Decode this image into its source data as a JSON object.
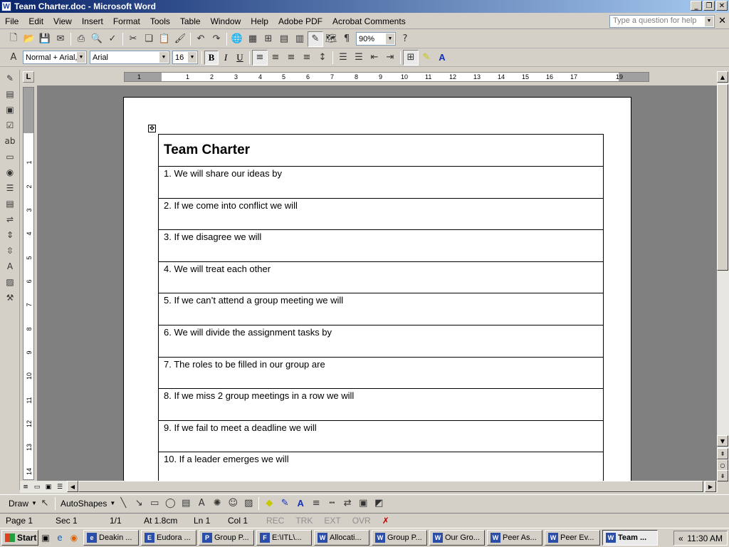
{
  "window": {
    "title": "Team Charter.doc - Microsoft Word",
    "app_icon": "W"
  },
  "menu": [
    "File",
    "Edit",
    "View",
    "Insert",
    "Format",
    "Tools",
    "Table",
    "Window",
    "Help",
    "Adobe PDF",
    "Acrobat Comments"
  ],
  "help_box": {
    "placeholder": "Type a question for help"
  },
  "standard_toolbar": {
    "zoom": "90%"
  },
  "formatting_toolbar": {
    "style": "Normal + Arial,",
    "font": "Arial",
    "size": "16",
    "bold": "B",
    "italic": "I",
    "underline": "U"
  },
  "ruler": {
    "h_numbers": [
      "1",
      "1",
      "2",
      "3",
      "4",
      "5",
      "6",
      "7",
      "8",
      "9",
      "10",
      "11",
      "12",
      "13",
      "14",
      "15",
      "16",
      "17",
      "19"
    ],
    "v_numbers": [
      "1",
      "2",
      "3",
      "4",
      "5",
      "6",
      "7",
      "8",
      "9",
      "10",
      "11",
      "12",
      "13",
      "14"
    ]
  },
  "document": {
    "title": "Team Charter",
    "rows": [
      "1. We will share our ideas by",
      "2. If we come into conflict we will",
      "3. If we disagree we will",
      "4. We will treat each other",
      "5. If we can’t attend a group meeting we will",
      "6. We will divide the assignment tasks by",
      "7. The roles to be filled in our group are",
      "8. If we miss 2 group meetings in a row we will",
      "9. If we fail to meet a deadline we will",
      "10. If a leader emerges we will"
    ]
  },
  "drawing_toolbar": {
    "draw": "Draw",
    "autoshapes": "AutoShapes"
  },
  "status": {
    "page": "Page 1",
    "sec": "Sec 1",
    "pages": "1/1",
    "at": "At 1.8cm",
    "ln": "Ln 1",
    "col": "Col 1",
    "rec": "REC",
    "trk": "TRK",
    "ext": "EXT",
    "ovr": "OVR"
  },
  "taskbar": {
    "start": "Start",
    "tasks": [
      {
        "label": "Deakin ...",
        "icon": "e"
      },
      {
        "label": "Eudora ...",
        "icon": "E"
      },
      {
        "label": "Group P...",
        "icon": "P"
      },
      {
        "label": "E:\\ITL\\...",
        "icon": "F"
      },
      {
        "label": "Allocati...",
        "icon": "W"
      },
      {
        "label": "Group P...",
        "icon": "W"
      },
      {
        "label": "Our Gro...",
        "icon": "W"
      },
      {
        "label": "Peer As...",
        "icon": "W"
      },
      {
        "label": "Peer Ev...",
        "icon": "W"
      },
      {
        "label": "Team ...",
        "icon": "W"
      }
    ],
    "clock": "11:30 AM"
  }
}
